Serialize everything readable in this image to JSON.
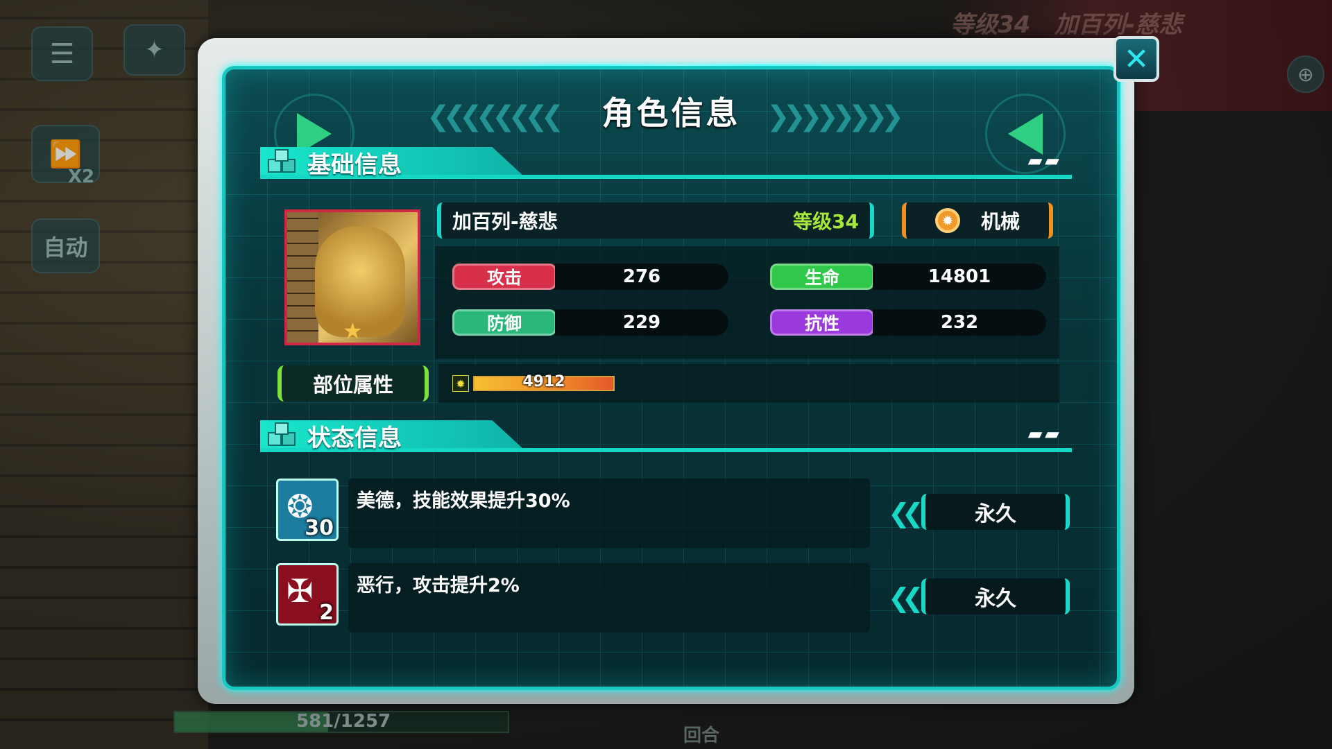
{
  "dialog": {
    "title": "角色信息",
    "close_label": "✕"
  },
  "basic_section": {
    "title": "基础信息"
  },
  "character": {
    "name": "加百列-慈悲",
    "level": "等级34",
    "type": "机械"
  },
  "stats": [
    {
      "label": "攻击",
      "value": "276",
      "color": "#d8304a"
    },
    {
      "label": "生命",
      "value": "14801",
      "color": "#2fc84a"
    },
    {
      "label": "防御",
      "value": "229",
      "color": "#2ab87a"
    },
    {
      "label": "抗性",
      "value": "232",
      "color": "#9a3adc"
    }
  ],
  "part_attribute": {
    "label": "部位属性",
    "value": "4912",
    "fill_fraction": 1.0
  },
  "status_section": {
    "title": "状态信息"
  },
  "statuses": [
    {
      "description": "美德，技能效果提升30%",
      "count": "30",
      "duration": "永久",
      "icon": "angel-halo-icon",
      "icon_color": "#1c7da0"
    },
    {
      "description": "恶行，攻击提升2%",
      "count": "2",
      "duration": "永久",
      "icon": "demon-emblem-icon",
      "icon_color": "#8a1020"
    }
  ],
  "background_hud": {
    "header_level": "等级34",
    "header_name": "加百列-慈悲",
    "speed_label": "X2",
    "auto_label": "自动",
    "hp_text": "581/1257",
    "round_label": "回合"
  }
}
